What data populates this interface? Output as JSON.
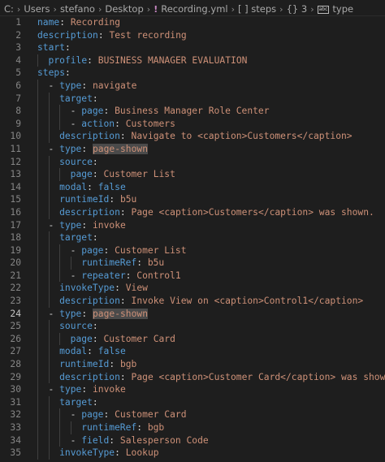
{
  "breadcrumb": {
    "parts": [
      "C:",
      "Users",
      "stefano",
      "Desktop",
      "Recording.yml",
      "[ ] steps",
      "{} 3",
      "type"
    ],
    "separator": "›",
    "icons": [
      "yaml-file-icon",
      "array-icon",
      "object-icon",
      "string-symbol-icon"
    ]
  },
  "editor": {
    "active_line": 24,
    "highlight_word": "page-shown",
    "lines": [
      {
        "n": "1",
        "indent": 0,
        "dash": false,
        "key": "name",
        "value": "Recording"
      },
      {
        "n": "2",
        "indent": 0,
        "dash": false,
        "key": "description",
        "value": "Test recording"
      },
      {
        "n": "3",
        "indent": 0,
        "dash": false,
        "key": "start",
        "value": ""
      },
      {
        "n": "4",
        "indent": 1,
        "dash": false,
        "key": "profile",
        "value": "BUSINESS MANAGER EVALUATION"
      },
      {
        "n": "5",
        "indent": 0,
        "dash": false,
        "key": "steps",
        "value": ""
      },
      {
        "n": "6",
        "indent": 1,
        "dash": true,
        "key": "type",
        "value": "navigate"
      },
      {
        "n": "7",
        "indent": 2,
        "dash": false,
        "key": "target",
        "value": ""
      },
      {
        "n": "8",
        "indent": 3,
        "dash": true,
        "key": "page",
        "value": "Business Manager Role Center"
      },
      {
        "n": "9",
        "indent": 3,
        "dash": true,
        "key": "action",
        "value": "Customers"
      },
      {
        "n": "10",
        "indent": 2,
        "dash": false,
        "key": "description",
        "value": "Navigate to <caption>Customers</caption>"
      },
      {
        "n": "11",
        "indent": 1,
        "dash": true,
        "key": "type",
        "value": "page-shown",
        "hl": true
      },
      {
        "n": "12",
        "indent": 2,
        "dash": false,
        "key": "source",
        "value": ""
      },
      {
        "n": "13",
        "indent": 3,
        "dash": false,
        "key": "page",
        "value": "Customer List"
      },
      {
        "n": "14",
        "indent": 2,
        "dash": false,
        "key": "modal",
        "value": "false",
        "boolean": true
      },
      {
        "n": "15",
        "indent": 2,
        "dash": false,
        "key": "runtimeId",
        "value": "b5u"
      },
      {
        "n": "16",
        "indent": 2,
        "dash": false,
        "key": "description",
        "value": "Page <caption>Customers</caption> was shown."
      },
      {
        "n": "17",
        "indent": 1,
        "dash": true,
        "key": "type",
        "value": "invoke"
      },
      {
        "n": "18",
        "indent": 2,
        "dash": false,
        "key": "target",
        "value": ""
      },
      {
        "n": "19",
        "indent": 3,
        "dash": true,
        "key": "page",
        "value": "Customer List"
      },
      {
        "n": "20",
        "indent": 4,
        "dash": false,
        "key": "runtimeRef",
        "value": "b5u"
      },
      {
        "n": "21",
        "indent": 3,
        "dash": true,
        "key": "repeater",
        "value": "Control1"
      },
      {
        "n": "22",
        "indent": 2,
        "dash": false,
        "key": "invokeType",
        "value": "View"
      },
      {
        "n": "23",
        "indent": 2,
        "dash": false,
        "key": "description",
        "value": "Invoke View on <caption>Control1</caption>"
      },
      {
        "n": "24",
        "indent": 1,
        "dash": true,
        "key": "type",
        "value": "page-shown",
        "hl": true
      },
      {
        "n": "25",
        "indent": 2,
        "dash": false,
        "key": "source",
        "value": ""
      },
      {
        "n": "26",
        "indent": 3,
        "dash": false,
        "key": "page",
        "value": "Customer Card"
      },
      {
        "n": "27",
        "indent": 2,
        "dash": false,
        "key": "modal",
        "value": "false",
        "boolean": true
      },
      {
        "n": "28",
        "indent": 2,
        "dash": false,
        "key": "runtimeId",
        "value": "bgb"
      },
      {
        "n": "29",
        "indent": 2,
        "dash": false,
        "key": "description",
        "value": "Page <caption>Customer Card</caption> was shown."
      },
      {
        "n": "30",
        "indent": 1,
        "dash": true,
        "key": "type",
        "value": "invoke"
      },
      {
        "n": "31",
        "indent": 2,
        "dash": false,
        "key": "target",
        "value": ""
      },
      {
        "n": "32",
        "indent": 3,
        "dash": true,
        "key": "page",
        "value": "Customer Card"
      },
      {
        "n": "33",
        "indent": 4,
        "dash": false,
        "key": "runtimeRef",
        "value": "bgb"
      },
      {
        "n": "34",
        "indent": 3,
        "dash": true,
        "key": "field",
        "value": "Salesperson Code"
      },
      {
        "n": "35",
        "indent": 2,
        "dash": false,
        "key": "invokeType",
        "value": "Lookup"
      }
    ]
  },
  "colors": {
    "background": "#1e1e1e",
    "key": "#569cd6",
    "string": "#ce9178",
    "line_number": "#858585",
    "highlight": "#4a4a4a"
  }
}
